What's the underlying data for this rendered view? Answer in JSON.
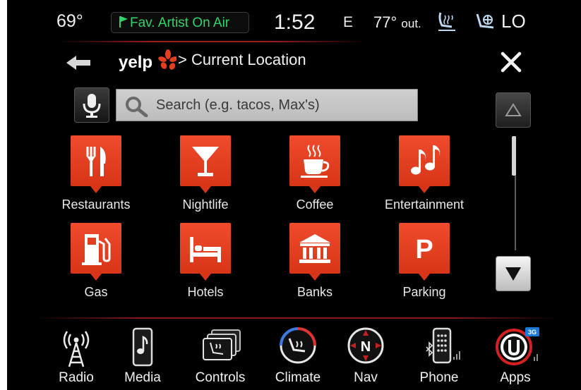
{
  "status": {
    "temperature_left": "69°",
    "favorite_alert": "Fav. Artist On Air",
    "clock": "1:52",
    "compass": "E",
    "outside_value": "77°",
    "outside_suffix": "out.",
    "fan_level": "LO"
  },
  "header": {
    "brand": "yelp",
    "breadcrumb": "> Current Location"
  },
  "search": {
    "placeholder": "Search (e.g. tacos, Max's)"
  },
  "categories": [
    {
      "label": "Restaurants",
      "icon": "fork-knife-icon"
    },
    {
      "label": "Nightlife",
      "icon": "cocktail-icon"
    },
    {
      "label": "Coffee",
      "icon": "coffee-cup-icon"
    },
    {
      "label": "Entertainment",
      "icon": "music-notes-icon"
    },
    {
      "label": "Gas",
      "icon": "gas-pump-icon"
    },
    {
      "label": "Hotels",
      "icon": "bed-icon"
    },
    {
      "label": "Banks",
      "icon": "bank-icon"
    },
    {
      "label": "Parking",
      "icon": "parking-icon",
      "glyph": "P"
    }
  ],
  "scroll": {
    "position_fraction": 0.0
  },
  "dock": [
    {
      "label": "Radio",
      "icon": "radio-tower-icon"
    },
    {
      "label": "Media",
      "icon": "media-player-icon"
    },
    {
      "label": "Controls",
      "icon": "controls-icon"
    },
    {
      "label": "Climate",
      "icon": "climate-icon"
    },
    {
      "label": "Nav",
      "icon": "compass-icon",
      "glyph": "N"
    },
    {
      "label": "Phone",
      "icon": "phone-icon"
    },
    {
      "label": "Apps",
      "icon": "uconnect-apps-icon",
      "badge": "3G"
    }
  ],
  "colors": {
    "accent_red": "#e23f1f",
    "status_green": "#2fd46a",
    "background": "#000000"
  }
}
